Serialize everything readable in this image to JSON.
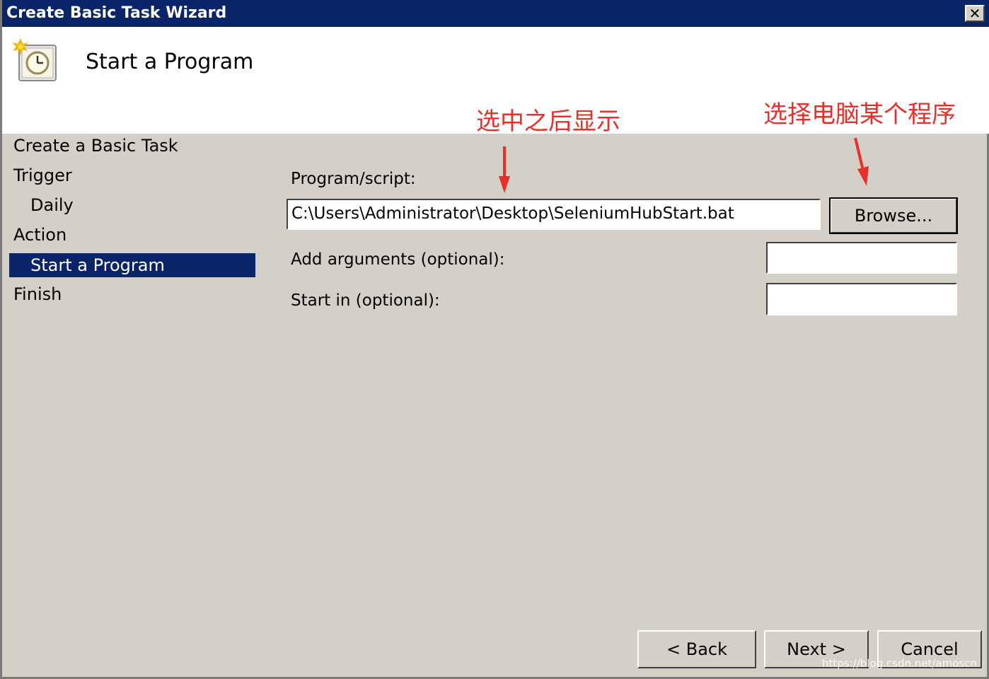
{
  "window": {
    "title": "Create Basic Task Wizard",
    "close_label": "✕"
  },
  "header": {
    "title": "Start a Program",
    "icon": "task-clock-icon"
  },
  "annotations": {
    "selected_display": "选中之后显示",
    "choose_program": "选择电脑某个程序",
    "color": "#e8302a"
  },
  "nav": {
    "items": [
      {
        "label": "Create a Basic Task"
      },
      {
        "label": "Trigger"
      },
      {
        "label": "Daily"
      },
      {
        "label": "Action"
      },
      {
        "label": "Start a Program"
      },
      {
        "label": "Finish"
      }
    ],
    "selected_color": "#0a246a"
  },
  "form": {
    "program_label": "Program/script:",
    "program_value": "C:\\Users\\Administrator\\Desktop\\SeleniumHubStart.bat",
    "browse_label": "Browse...",
    "args_label": "Add arguments (optional):",
    "args_value": "",
    "startin_label": "Start in (optional):",
    "startin_value": ""
  },
  "footer": {
    "back_label": "< Back",
    "next_label": "Next >",
    "cancel_label": "Cancel"
  },
  "watermark": "https://blog.csdn.net/amoscn"
}
